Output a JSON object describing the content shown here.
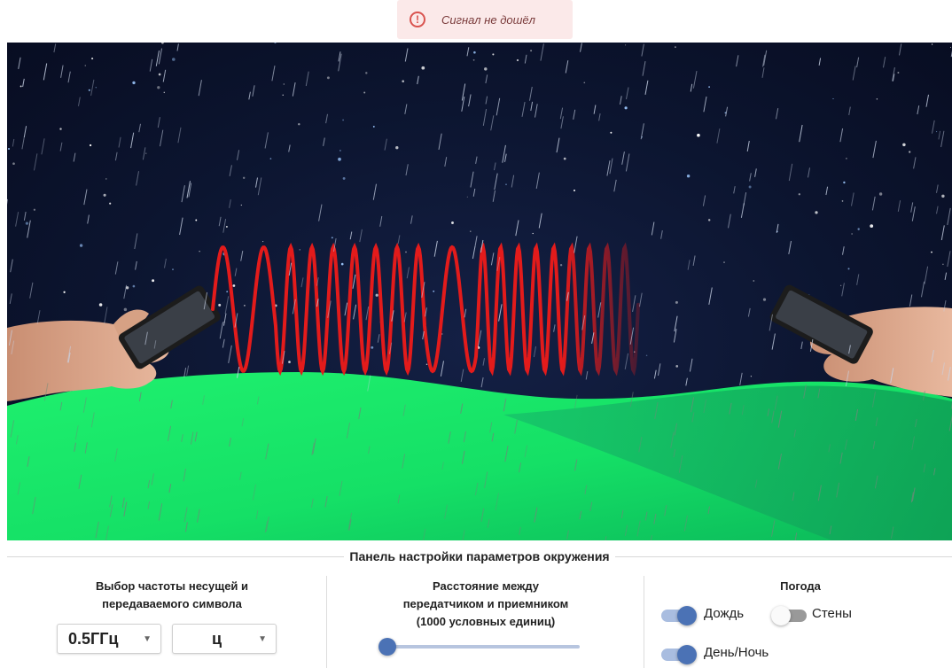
{
  "alert": {
    "icon": "exclamation-circle-icon",
    "message": "Сигнал не дошёл",
    "color": "#d9534f"
  },
  "scene": {
    "weather": "rain",
    "time": "night",
    "signal_color": "#e31b1b",
    "ground_color": "#1fe36a"
  },
  "panel": {
    "title": "Панель настройки параметров окружения",
    "frequency": {
      "title_line1": "Выбор частоты несущей и",
      "title_line2": "передаваемого символа",
      "carrier_value": "0.5ГГц",
      "symbol_value": "ц"
    },
    "distance": {
      "title_line1": "Расстояние между",
      "title_line2": "передатчиком и приемником",
      "title_line3": "(1000 условных единиц)",
      "slider_fraction": 0.0
    },
    "weather": {
      "title": "Погода",
      "rain_label": "Дождь",
      "rain_on": true,
      "walls_label": "Стены",
      "walls_on": false,
      "daynight_label": "День/Ночь",
      "daynight_on": true
    }
  }
}
